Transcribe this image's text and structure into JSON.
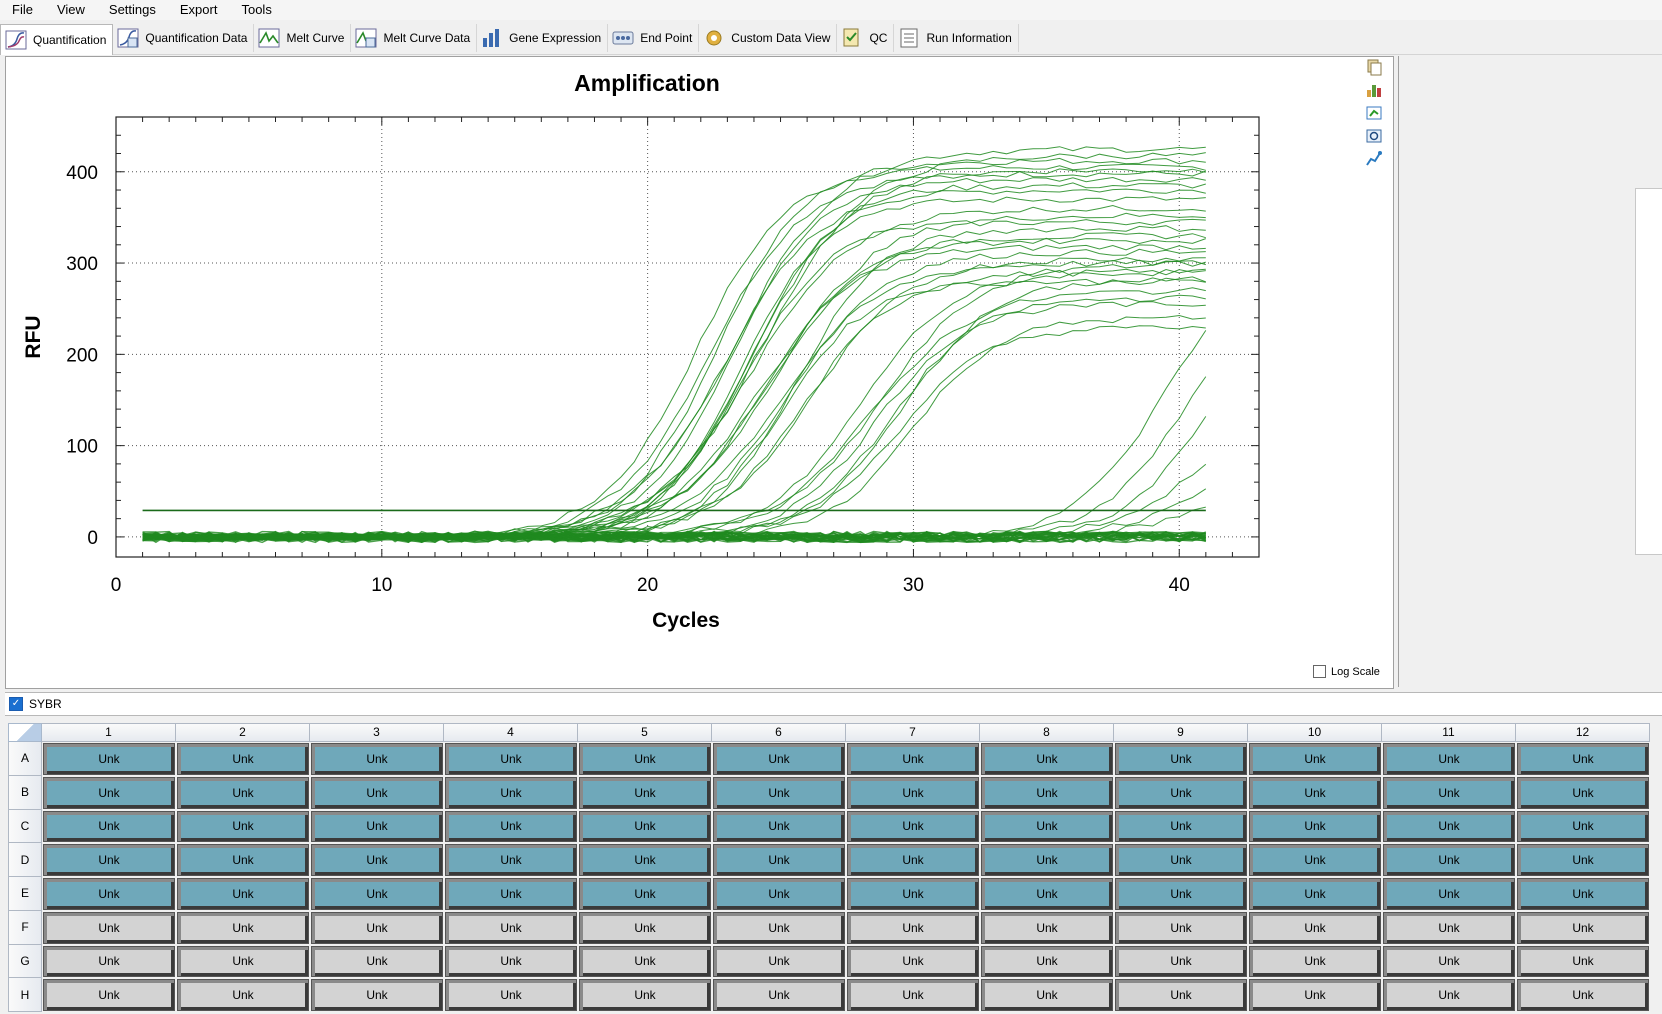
{
  "menu": [
    "File",
    "View",
    "Settings",
    "Export",
    "Tools"
  ],
  "tabs": [
    {
      "label": "Quantification",
      "icon": "quantification-icon",
      "active": true
    },
    {
      "label": "Quantification Data",
      "icon": "quantification-data-icon"
    },
    {
      "label": "Melt Curve",
      "icon": "melt-curve-icon"
    },
    {
      "label": "Melt Curve Data",
      "icon": "melt-curve-data-icon"
    },
    {
      "label": "Gene Expression",
      "icon": "gene-expression-icon"
    },
    {
      "label": "End Point",
      "icon": "end-point-icon"
    },
    {
      "label": "Custom Data View",
      "icon": "custom-data-view-icon"
    },
    {
      "label": "QC",
      "icon": "qc-icon"
    },
    {
      "label": "Run Information",
      "icon": "run-information-icon"
    }
  ],
  "chart_data": {
    "type": "line",
    "title": "Amplification",
    "xlabel": "Cycles",
    "ylabel": "RFU",
    "xlim": [
      0,
      43
    ],
    "ylim": [
      -22,
      460
    ],
    "xticks": [
      0,
      10,
      20,
      30,
      40
    ],
    "yticks": [
      0,
      100,
      200,
      300,
      400
    ],
    "grid": true,
    "threshold": 29,
    "line_color": "#1f8a1f",
    "series_groups": [
      {
        "name": "",
        "midpoints": [
          21.8,
          22.3,
          22.6,
          22.9,
          23.1,
          23.3,
          23.5,
          23.8,
          24.0,
          24.3
        ],
        "plateaus": [
          405,
          398,
          412,
          380,
          392,
          425,
          370,
          385,
          402,
          418
        ]
      },
      {
        "name": "",
        "midpoints": [
          23.6,
          23.9,
          24.2,
          24.5,
          24.8,
          25.0,
          25.3,
          25.6,
          25.9,
          26.2,
          24.4,
          25.1
        ],
        "plateaus": [
          345,
          360,
          318,
          330,
          352,
          300,
          312,
          338,
          290,
          305,
          325,
          280
        ]
      },
      {
        "name": "",
        "midpoints": [
          28.0,
          28.4,
          28.8,
          29.2,
          29.6,
          30.0,
          28.6,
          29.4
        ],
        "plateaus": [
          290,
          270,
          300,
          262,
          282,
          240,
          255,
          230
        ]
      },
      {
        "name": "",
        "midpoints": [
          39.5,
          40.2,
          41.0,
          41.8,
          42.5,
          43.2
        ],
        "plateaus": [
          320,
          280,
          260,
          210,
          180,
          150
        ]
      }
    ]
  },
  "log_scale": {
    "label": "Log Scale",
    "checked": false
  },
  "sybr": {
    "label": "SYBR",
    "checked": true
  },
  "plate": {
    "columns": [
      "1",
      "2",
      "3",
      "4",
      "5",
      "6",
      "7",
      "8",
      "9",
      "10",
      "11",
      "12"
    ],
    "rows": [
      "A",
      "B",
      "C",
      "D",
      "E",
      "F",
      "G",
      "H"
    ],
    "well_label": "Unk",
    "selected_rows": [
      "A",
      "B",
      "C",
      "D",
      "E"
    ],
    "selected_color": "#6fa8ba",
    "unselected_color": "#d3d3d3"
  }
}
